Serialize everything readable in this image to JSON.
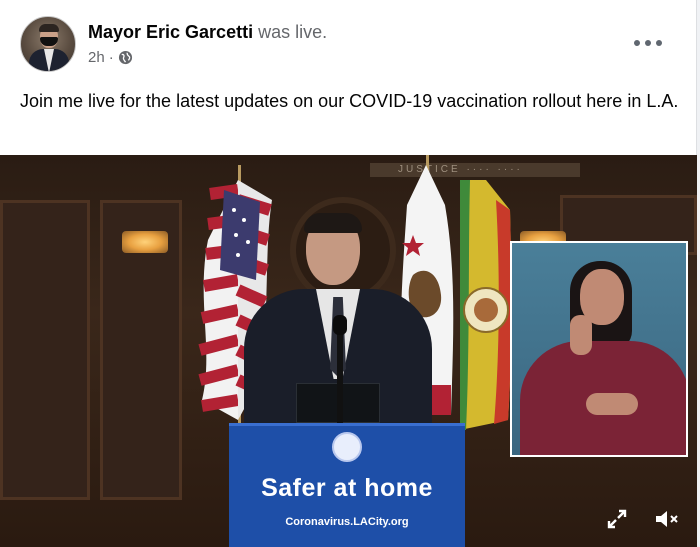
{
  "post": {
    "author": "Mayor Eric Garcetti",
    "status": "was live.",
    "time": "2h",
    "separator": "·",
    "audience_icon": "globe-icon",
    "more_icon": "more-horizontal-icon",
    "text": "Join me live for the latest updates on our COVID-19 vaccination rollout here in L.A."
  },
  "video": {
    "wall_inscription": "JUSTICE ···· ····",
    "podium_title": "Safer at home",
    "podium_url": "Coronavirus.LACity.org",
    "controls": {
      "fullscreen_icon": "fullscreen-icon",
      "volume_icon": "volume-muted-icon"
    }
  },
  "colors": {
    "text": "#050505",
    "secondary": "#65676b",
    "podium_blue": "#1e4fa8",
    "interpreter_bg": "#3f6e86",
    "interpreter_shirt": "#7b2336"
  }
}
